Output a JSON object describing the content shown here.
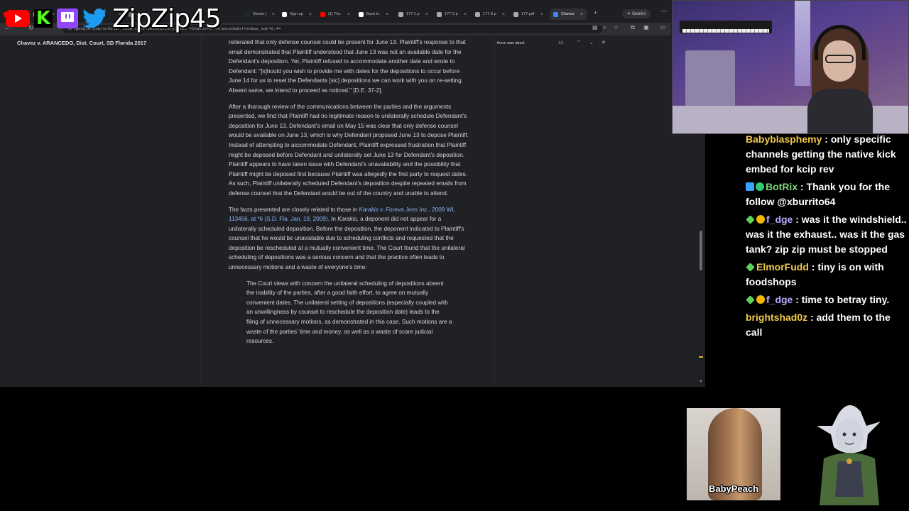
{
  "browser": {
    "tabs": [
      {
        "label": "",
        "color": "#ff0000"
      },
      {
        "label": "",
        "color": "#53fc18"
      },
      {
        "label": "",
        "color": "#9146ff"
      },
      {
        "label": "",
        "color": "#1d9bf0"
      },
      {
        "label": "",
        "color": "#777"
      },
      {
        "label": "Steam |",
        "color": "#1b2838"
      },
      {
        "label": "Sign up",
        "color": "#ffffff"
      },
      {
        "label": "(1) The",
        "color": "#ff0000"
      },
      {
        "label": "Back to",
        "color": "#ffffff"
      },
      {
        "label": "177-1.p",
        "color": "#aaaaaa"
      },
      {
        "label": "177-2.p",
        "color": "#aaaaaa"
      },
      {
        "label": "177-3.p",
        "color": "#aaaaaa"
      },
      {
        "label": "177.pdf",
        "color": "#aaaaaa"
      },
      {
        "label": "Chavez",
        "color": "#4285f4",
        "active": true
      }
    ],
    "gemini_label": "Gemini",
    "url": "ar.google.com/scholar_case?case=5036032187673165 =Chavez+v.+Arancedo&hl=en&as_sdt=6,44",
    "find": {
      "query": "there was absol",
      "count": "1/1"
    }
  },
  "case_title": "Chavez v. ARANCEDO, Dist. Court, SD Florida 2017",
  "doc": {
    "p1": "reiterated that only defense counsel could be present for June 13. Plaintiff's response to that email demonstrated that Plaintiff understood that June 13 was not an available date for the Defendant's deposition. Yet, Plaintiff refused to accommodate another date and wrote to Defendant: \"[s]hould you wish to provide me with dates for the depositions to occur before June 14 for us to reset the Defendants [sic] depositions we can work with you on re-setting. Absent same, we intend to proceed as noticed.\" [D.E. 37-2].",
    "p2": "After a thorough review of the communications between the parties and the arguments presented, we find that Plaintiff had no legitimate reason to unilaterally schedule Defendant's deposition for June 13. Defendant's email on May 15 was clear that only defense counsel would be available on June 13, which is why Defendant proposed June 13 to depose Plaintiff. Instead of attempting to accommodate Defendant, Plaintiff expressed frustration that Plaintiff might be deposed before Defendant and unilaterally set June 13 for Defendant's deposition. Plaintiff appears to have taken issue with Defendant's unavailability and the possibility that Plaintiff might be deposed first because Plaintiff was allegedly the first party to request dates. As such, Plaintiff unilaterally scheduled Defendant's deposition despite repeated emails from defense counsel that the Defendant would be out of the country and unable to attend.",
    "p3_pre": "The facts presented are closely related to those in ",
    "p3_link": "Karakis v. Foreva Jens Inc.,",
    "p3_cite": "2009 WL 113456, at *6 (S.D. Fla. Jan. 19, 2009)",
    "p3_mid": ". In ",
    "p3_em": "Karakis",
    "p3_post": ", a deponent did not appear for a unilaterally scheduled deposition. Before the deposition, the deponent indicated to Plaintiff's counsel that he would be unavailable due to scheduling conflicts and requested that the deposition be rescheduled at a mutually convenient time. The Court found that the unilateral scheduling of depositions was a serious concern and that the practice often leads to unnecessary motions and a waste of everyone's time:",
    "quote": "The Court views with concern the unilateral scheduling of depositions absent the inability of the parties, after a good faith effort, to agree on mutually convenient dates. The unilateral setting of depositions (especially coupled with an unwillingness by counsel to reschedule the deposition date) leads to the filing of unnecessary motions, as demonstrated in this case. Such motions are a waste of the parties' time and money, as well as a waste of scare judicial resources."
  },
  "overlay": {
    "handle": "ZipZip45",
    "social_icons": [
      "youtube-icon",
      "kick-icon",
      "twitch-icon",
      "twitter-icon"
    ]
  },
  "chat": [
    {
      "user": "Babyblasphemy",
      "text": " : only specific channels getting the native kick embed for kcip rev",
      "style": "gold",
      "badges": []
    },
    {
      "user": "BotRix",
      "text": " : Thank you for the follow @xburrito64",
      "style": "green",
      "badges": [
        "blue",
        "green"
      ]
    },
    {
      "user": "f_dge",
      "text": " : was it the windshield.. was it the exhaust.. was it the gas tank? zip zip must be stopped",
      "style": "lav",
      "badges": [
        "gem",
        "gold"
      ]
    },
    {
      "user": "ElmorFudd",
      "text": " : tiny is on with foodshops",
      "style": "gold",
      "badges": [
        "gem"
      ]
    },
    {
      "user": "f_dge",
      "text": " : time to betray tiny.",
      "style": "lav",
      "badges": [
        "gem",
        "gold"
      ]
    },
    {
      "user": "brightshad0z",
      "text": " : add them to the call",
      "style": "gold",
      "badges": []
    }
  ],
  "cam2_name": "BabyPeach"
}
